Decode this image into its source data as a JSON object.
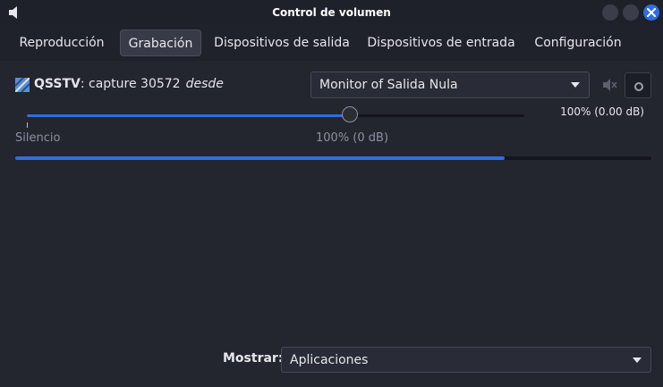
{
  "window": {
    "title": "Control de volumen",
    "accent_color": "#2f6de1"
  },
  "tabs": [
    {
      "label": "Reproducción",
      "active": false
    },
    {
      "label": "Grabación",
      "active": true
    },
    {
      "label": "Dispositivos de salida",
      "active": false
    },
    {
      "label": "Dispositivos de entrada",
      "active": false
    },
    {
      "label": "Configuración",
      "active": false
    }
  ],
  "stream": {
    "icon": "qsstv-app-icon",
    "name": "QSSTV",
    "detail": ": capture 30572",
    "from_label": "desde",
    "source_device": "Monitor of Salida Nula",
    "volume_readout": "100% (0.00 dB)",
    "volume_fraction": 0.65,
    "mute_icon": "speaker-muted-icon",
    "lock_icon": "lock-channels-icon",
    "slider_silence_label": "Silencio",
    "slider_mid_label": "100% (0 dB)",
    "peak_level_fraction": 0.77
  },
  "footer": {
    "show_label": "Mostrar:",
    "show_value": "Aplicaciones"
  }
}
